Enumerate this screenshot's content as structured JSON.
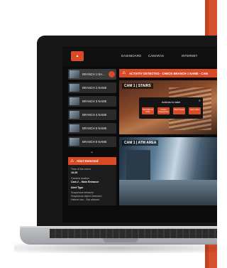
{
  "app": {
    "logo_text": ""
  },
  "nav": {
    "items": [
      {
        "label": "DASHBOARD"
      },
      {
        "label": "CAMARAS"
      },
      {
        "label": "INTERNET"
      }
    ]
  },
  "banner": {
    "text": "ACTIVITY DETECTED - CHECK BRANCH 1 NAME - CAM"
  },
  "sidebar": {
    "branches": [
      {
        "label": "BRANCH 1 NA..."
      },
      {
        "label": "BRANCH 2 NAME"
      },
      {
        "label": "BRANCH 3 NAME"
      },
      {
        "label": "BRANCH 4 NAME"
      },
      {
        "label": "BRANCH 5 NAME"
      },
      {
        "label": "BRANCH 6 NAME"
      }
    ]
  },
  "alert": {
    "title": "Alert Detected",
    "time_label": "Time of the event",
    "time_value": "10:25",
    "location_label": "Camera location",
    "location_value": "Cam 2 – Main Entrance",
    "type_label": "Alert Type",
    "type_lines": [
      "Suspicious behavior",
      "Suspicious object Detected",
      "Helmet use - Not allowed"
    ]
  },
  "cameras": [
    {
      "label": "CAM 1 | STAIRS"
    },
    {
      "label": "CAM 1 | ATM AREA"
    }
  ],
  "popup": {
    "title": "Actions to take",
    "buttons": [
      "Send Alarm to Police",
      "Contact Headquarters",
      "Watch Replay",
      "Alarm Video"
    ]
  },
  "colors": {
    "accent": "#d94a26",
    "dark": "#0b0b0b"
  }
}
